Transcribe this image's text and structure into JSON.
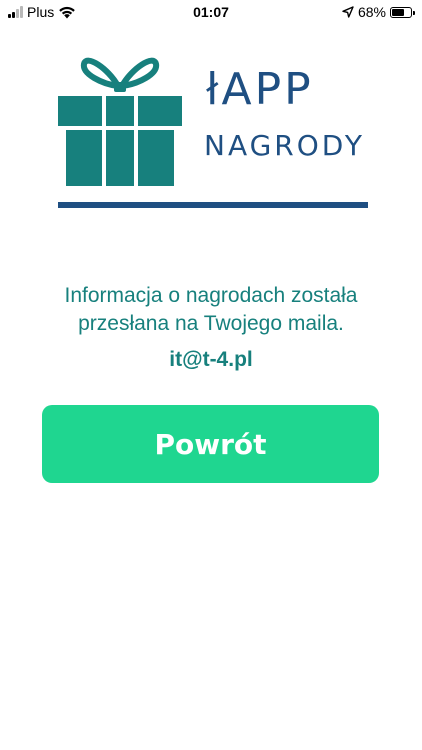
{
  "status_bar": {
    "carrier": "Plus",
    "time": "01:07",
    "battery_percent": "68%",
    "battery_level": 0.68,
    "icons": [
      "signal-icon",
      "wifi-icon",
      "location-arrow-icon",
      "battery-icon"
    ]
  },
  "logo": {
    "title": "łAPP",
    "subtitle": "NAGRODY",
    "icon": "gift-icon"
  },
  "message": {
    "text": "Informacja o nagrodach została przesłana na Twojego maila.",
    "email": "it@t-4.pl"
  },
  "actions": {
    "back_label": "Powrót"
  },
  "colors": {
    "brand_teal": "#17807d",
    "brand_navy": "#1f4f82",
    "button_green": "#1fd690"
  }
}
